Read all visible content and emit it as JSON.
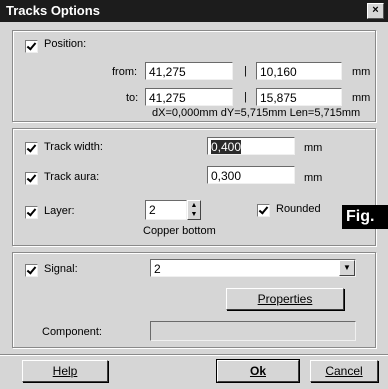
{
  "window": {
    "title": "Tracks Options",
    "close_glyph": "×"
  },
  "position": {
    "label": "Position:",
    "from_label": "from:",
    "to_label": "to:",
    "from_x": "41,275",
    "from_y": "10,160",
    "to_x": "41,275",
    "to_y": "15,875",
    "divider": "|",
    "unit": "mm",
    "delta": "dX=0,000mm dY=5,715mm Len=5,715mm",
    "checked": true
  },
  "track": {
    "width_label": "Track width:",
    "width_value": "0,400",
    "aura_label": "Track aura:",
    "aura_value": "0,300",
    "unit": "mm",
    "layer_label": "Layer:",
    "layer_value": "2",
    "layer_name": "Copper bottom",
    "rounded_label": "Rounded"
  },
  "signal": {
    "label": "Signal:",
    "value": "2",
    "properties_button": "Properties",
    "component_label": "Component:",
    "component_value": ""
  },
  "buttons": {
    "help": "Help",
    "ok": "Ok",
    "cancel": "Cancel"
  },
  "overlay": {
    "fig_label": "Fig."
  },
  "icons": {
    "spin_up": "▲",
    "spin_down": "▼",
    "dropdown": "▼"
  }
}
